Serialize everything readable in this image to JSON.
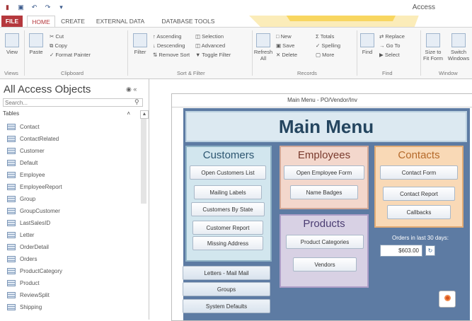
{
  "app": {
    "title": "Access"
  },
  "quick_access": [
    "app-icon",
    "save-icon",
    "undo-icon",
    "redo-icon",
    "customize-icon"
  ],
  "tabs": [
    {
      "label": "FILE"
    },
    {
      "label": "HOME"
    },
    {
      "label": "CREATE"
    },
    {
      "label": "EXTERNAL DATA"
    },
    {
      "label": "DATABASE TOOLS"
    }
  ],
  "ribbon": {
    "views": {
      "view": "View",
      "group": "Views"
    },
    "clipboard": {
      "paste": "Paste",
      "cut": "Cut",
      "copy": "Copy",
      "format_painter": "Format Painter",
      "group": "Clipboard"
    },
    "sort_filter": {
      "filter": "Filter",
      "ascending": "Ascending",
      "descending": "Descending",
      "remove_sort": "Remove Sort",
      "selection": "Selection",
      "advanced": "Advanced",
      "toggle_filter": "Toggle Filter",
      "group": "Sort & Filter"
    },
    "records": {
      "refresh": "Refresh All",
      "new": "New",
      "save": "Save",
      "delete": "Delete",
      "totals": "Totals",
      "spelling": "Spelling",
      "more": "More",
      "group": "Records"
    },
    "find": {
      "find": "Find",
      "replace": "Replace",
      "goto": "Go To",
      "select": "Select",
      "group": "Find"
    },
    "window": {
      "size": "Size to Fit Form",
      "switch": "Switch Windows",
      "group": "Window"
    }
  },
  "nav": {
    "title": "All Access Objects",
    "search_placeholder": "Search...",
    "section": "Tables",
    "items": [
      {
        "label": "Contact"
      },
      {
        "label": "ContactRelated"
      },
      {
        "label": "Customer"
      },
      {
        "label": "Default"
      },
      {
        "label": "Employee"
      },
      {
        "label": "EmployeeReport"
      },
      {
        "label": "Group"
      },
      {
        "label": "GroupCustomer"
      },
      {
        "label": "LastSalesID"
      },
      {
        "label": "Letter"
      },
      {
        "label": "OrderDetail"
      },
      {
        "label": "Orders"
      },
      {
        "label": "ProductCategory"
      },
      {
        "label": "Product"
      },
      {
        "label": "ReviewSplit"
      },
      {
        "label": "Shipping"
      }
    ]
  },
  "form": {
    "caption": "Main Menu - PO/Vendor/Inv",
    "title": "Main Menu",
    "customers": {
      "heading": "Customers",
      "buttons": [
        {
          "label": "Open Customers List"
        },
        {
          "label": "Mailing Labels"
        },
        {
          "label": "Customers By State"
        },
        {
          "label": "Customer Report"
        },
        {
          "label": "Missing Address"
        }
      ]
    },
    "employees": {
      "heading": "Employees",
      "buttons": [
        {
          "label": "Open Employee Form"
        },
        {
          "label": "Name Badges"
        }
      ]
    },
    "contacts": {
      "heading": "Contacts",
      "buttons": [
        {
          "label": "Contact Form"
        },
        {
          "label": "Contact Report"
        },
        {
          "label": "Callbacks"
        }
      ]
    },
    "products": {
      "heading": "Products",
      "buttons": [
        {
          "label": "Product Categories"
        },
        {
          "label": "Vendors"
        }
      ]
    },
    "bottom_buttons": [
      {
        "label": "Letters - Mail Mail"
      },
      {
        "label": "Groups"
      },
      {
        "label": "System Defaults"
      }
    ],
    "orders": {
      "label": "Orders in last 30 days:",
      "value": "$603.00"
    }
  },
  "colors": {
    "accent": "#b5383d",
    "form_bg": "#5d7ba3",
    "customers_panel": "#d2e6ee",
    "employees_panel": "#f3d7cc",
    "contacts_panel": "#f9d9b6",
    "products_panel": "#d8d1e4"
  }
}
